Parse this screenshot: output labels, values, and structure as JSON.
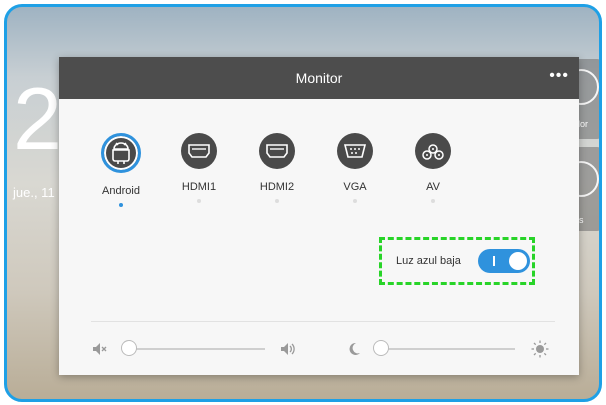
{
  "background": {
    "time_fragment": "2",
    "date_fragment": "jue., 11",
    "tile_labels": [
      "dor",
      "nes"
    ]
  },
  "panel": {
    "title": "Monitor",
    "more_icon": "•••"
  },
  "sources": [
    {
      "label": "Android",
      "icon": "android-icon",
      "active": true
    },
    {
      "label": "HDMI1",
      "icon": "hdmi-icon",
      "active": false
    },
    {
      "label": "HDMI2",
      "icon": "hdmi-icon",
      "active": false
    },
    {
      "label": "VGA",
      "icon": "vga-icon",
      "active": false
    },
    {
      "label": "AV",
      "icon": "av-icon",
      "active": false
    }
  ],
  "blue_light": {
    "label": "Luz azul baja",
    "toggle_text": "I",
    "enabled": true
  },
  "sliders": {
    "volume": {
      "icon_low": "volume-mute-icon",
      "icon_high": "volume-up-icon",
      "level_pct": 0
    },
    "brightness": {
      "icon_low": "moon-icon",
      "icon_high": "sun-icon",
      "level_pct": 0
    }
  },
  "colors": {
    "accent": "#2f92dd",
    "header": "#4d4d4d",
    "highlight": "#28d428",
    "frame": "#1ea0e6"
  }
}
